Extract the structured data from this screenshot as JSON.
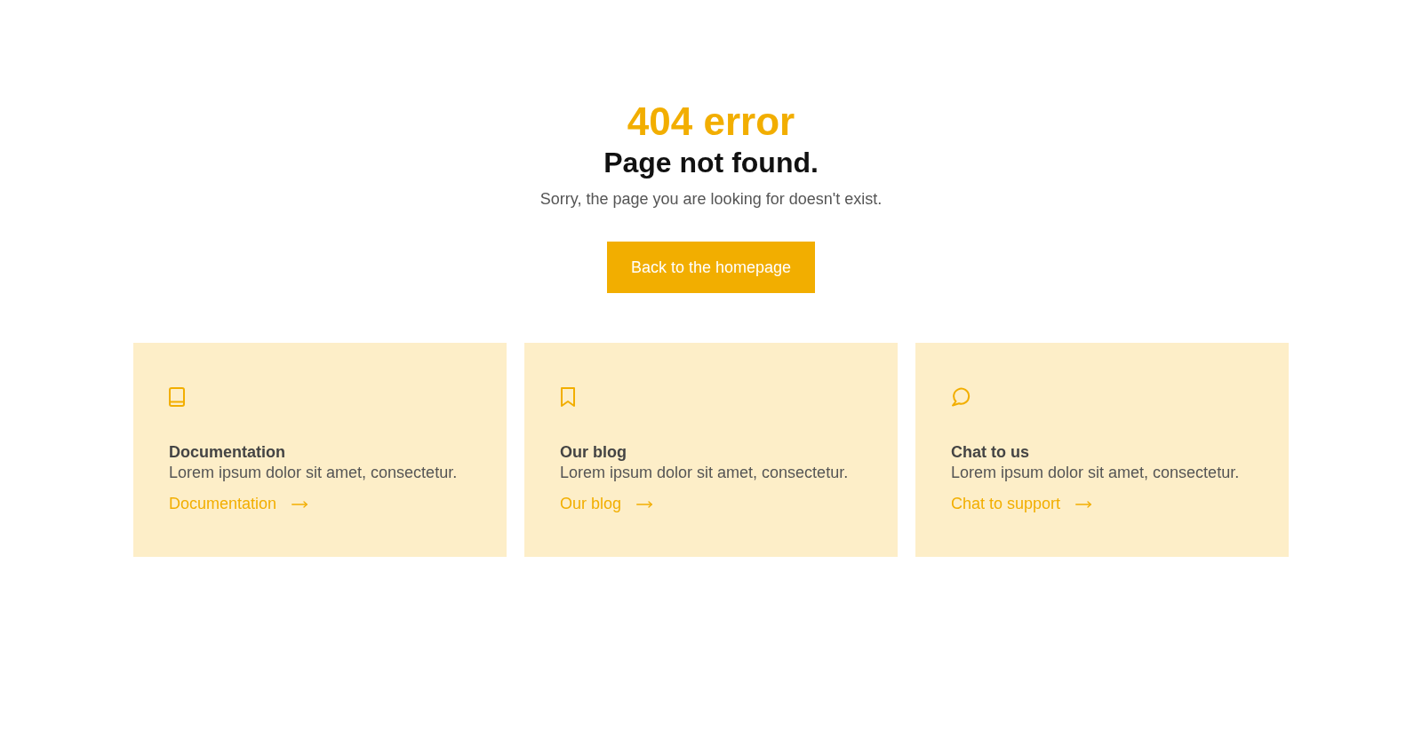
{
  "error": {
    "code": "404 error",
    "title": "Page not found.",
    "message": "Sorry, the page you are looking for doesn't exist."
  },
  "button": {
    "label": "Back to the homepage"
  },
  "cards": [
    {
      "title": "Documentation",
      "text": "Lorem ipsum dolor sit amet, consectetur.",
      "link": "Documentation"
    },
    {
      "title": "Our blog",
      "text": "Lorem ipsum dolor sit amet, consectetur.",
      "link": "Our blog"
    },
    {
      "title": "Chat to us",
      "text": "Lorem ipsum dolor sit amet, consectetur.",
      "link": "Chat to support"
    }
  ]
}
